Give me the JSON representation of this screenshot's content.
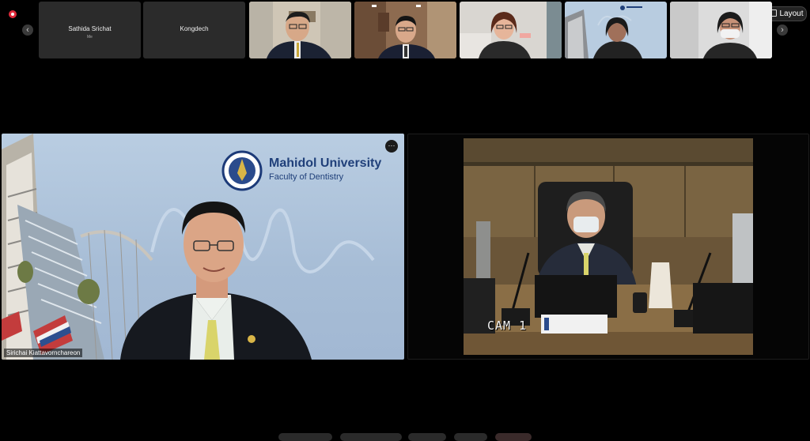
{
  "top_bar": {
    "layout_label": "Layout"
  },
  "thumbnails": [
    {
      "name": "Sathida Srichat",
      "sub": "Me",
      "type": "name"
    },
    {
      "name": "Kongdech",
      "sub": "",
      "type": "name"
    },
    {
      "type": "video",
      "icon": "person-video"
    },
    {
      "type": "video",
      "icon": "person-video"
    },
    {
      "type": "video",
      "icon": "person-video"
    },
    {
      "type": "video",
      "icon": "person-video"
    },
    {
      "type": "video",
      "icon": "person-video"
    }
  ],
  "main_speaker": {
    "name": "Sirichai Kiattavornchareon",
    "logo_title": "Mahidol University",
    "logo_subtitle": "Faculty of Dentistry",
    "more_icon": "ellipsis-icon"
  },
  "room_camera": {
    "overlay_text": "CAM 1"
  },
  "colors": {
    "background": "#000000",
    "thumb_bg": "#2b2b2b",
    "record": "#e02a3b",
    "slide_blue": "#a9bfd8",
    "logo_navy": "#20407a"
  }
}
